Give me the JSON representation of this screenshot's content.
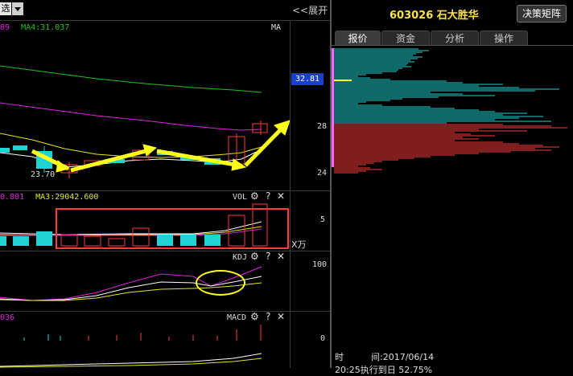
{
  "left": {
    "select_label": "选",
    "expand_label": "<<展开",
    "ma_row": {
      "prefix": "89",
      "ma4": "MA4:31.037",
      "tag": "MA"
    },
    "price_tag": "32.81",
    "axis_labels": [
      "28",
      "24"
    ],
    "low_label": "23.70",
    "vol_row": {
      "prefix": "0.801",
      "ma3": "MA3:29042.600",
      "tag": "VOL"
    },
    "vol_axis": "5",
    "vol_unit": "X万",
    "kdj_tag": "KDJ",
    "kdj_axis": "100",
    "macd_prefix": "036",
    "macd_tag": "MACD",
    "macd_axis": "0",
    "icons": {
      "gear": "⚙",
      "help": "?",
      "close": "✕"
    }
  },
  "right": {
    "stock_title": "603026 石大胜华",
    "matrix_button": "决策矩阵",
    "tabs": [
      "报价",
      "资金",
      "分析",
      "操作"
    ],
    "active_tab": 0,
    "footer": {
      "time_label": "时",
      "time_colon": "间:2017/06/14",
      "second_line": "20:25执行到日 52.75%"
    }
  },
  "colors": {
    "up": "#ff3b3b",
    "down": "#1fd3d3",
    "ma_green": "#1fc11f",
    "ma_magenta": "#e01fe0",
    "ma_yellow": "#e6e61f",
    "arrow": "#ffff1a",
    "annot": "#ff3b3b",
    "price_tag_bg": "#1a3fd0"
  }
}
